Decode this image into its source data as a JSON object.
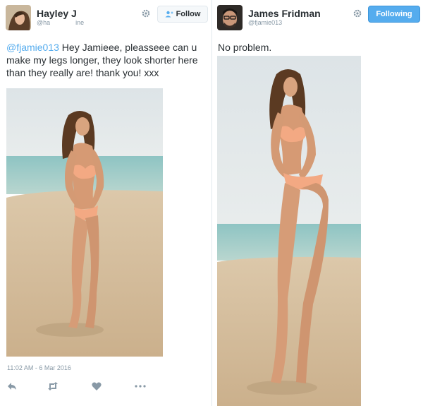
{
  "left_tweet": {
    "display_name": "Hayley J",
    "handle_prefix": "@ha",
    "handle_suffix": "ine",
    "follow_label": "Follow",
    "mention": "@fjamie013",
    "text": " Hey Jamieee, pleasseee can u make my legs longer, they look shorter here than they really are! thank you! xxx",
    "timestamp": "11:02 AM - 6 Mar 2016",
    "actions": [
      "reply-icon",
      "retweet-icon",
      "like-icon",
      "more-icon"
    ]
  },
  "right_tweet": {
    "display_name": "James Fridman",
    "handle": "@fjamie013",
    "following_label": "Following",
    "text": "No problem."
  },
  "colors": {
    "link": "#55acee",
    "following_bg": "#55acee",
    "text": "#292f33",
    "muted": "#8899a6"
  }
}
